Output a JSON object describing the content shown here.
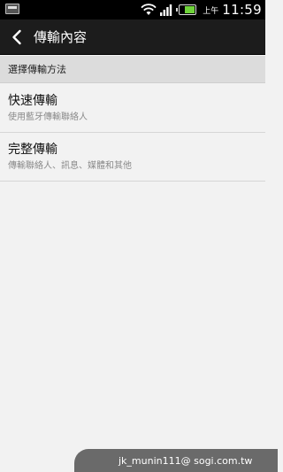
{
  "status_bar": {
    "ampm": "上午",
    "clock": "11:59",
    "battery_level": 0.6,
    "icons": [
      "notification-icon",
      "wifi-icon",
      "signal-icon",
      "battery-icon"
    ]
  },
  "action_bar": {
    "title": "傳輸內容",
    "back_icon": "chevron-left-icon"
  },
  "section": {
    "header": "選擇傳輸方法"
  },
  "options": [
    {
      "title": "快速傳輸",
      "subtitle": "使用藍牙傳輸聯絡人"
    },
    {
      "title": "完整傳輸",
      "subtitle": "傳輸聯絡人、訊息、媒體和其他"
    }
  ],
  "watermark": {
    "text": "jk_munin111@ sogi.com.tw"
  },
  "colors": {
    "status_bar_bg": "#000000",
    "action_bar_bg": "#1c1c1c",
    "section_header_bg": "#dcdcdc",
    "list_bg": "#f2f2f2",
    "battery_fill": "#6fd33a"
  }
}
